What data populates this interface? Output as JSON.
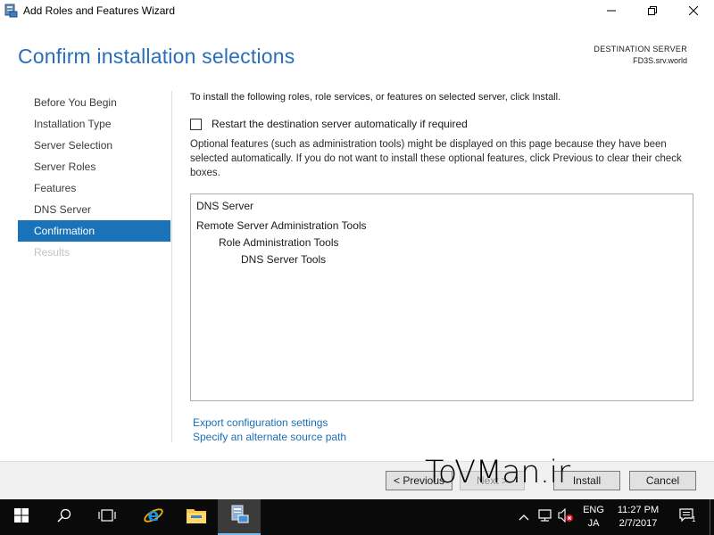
{
  "window": {
    "title": "Add Roles and Features Wizard"
  },
  "header": {
    "page_title": "Confirm installation selections",
    "destination_label": "DESTINATION SERVER",
    "destination_value": "FD3S.srv.world"
  },
  "nav": {
    "items": [
      {
        "label": "Before You Begin",
        "state": "normal"
      },
      {
        "label": "Installation Type",
        "state": "normal"
      },
      {
        "label": "Server Selection",
        "state": "normal"
      },
      {
        "label": "Server Roles",
        "state": "normal"
      },
      {
        "label": "Features",
        "state": "normal"
      },
      {
        "label": "DNS Server",
        "state": "normal"
      },
      {
        "label": "Confirmation",
        "state": "active"
      },
      {
        "label": "Results",
        "state": "disabled"
      }
    ]
  },
  "main": {
    "intro": "To install the following roles, role services, or features on selected server, click Install.",
    "restart_checkbox_label": "Restart the destination server automatically if required",
    "restart_checked": false,
    "optional_text": "Optional features (such as administration tools) might be displayed on this page because they have been selected automatically. If you do not want to install these optional features, click Previous to clear their check boxes.",
    "selections": [
      {
        "label": "DNS Server",
        "level": 0
      },
      {
        "label": "Remote Server Administration Tools",
        "level": 0
      },
      {
        "label": "Role Administration Tools",
        "level": 1
      },
      {
        "label": "DNS Server Tools",
        "level": 2
      }
    ],
    "export_link": "Export configuration settings",
    "alt_source_link": "Specify an alternate source path"
  },
  "footer": {
    "previous_label": "< Previous",
    "next_label": "Next >",
    "install_label": "Install",
    "cancel_label": "Cancel"
  },
  "watermark": "ToVMan.ir",
  "taskbar": {
    "lang_line1": "ENG",
    "lang_line2": "JA",
    "time": "11:27 PM",
    "date": "2/7/2017",
    "notification_count": "1"
  },
  "colors": {
    "accent": "#1a73b9",
    "title_blue": "#2a6ebb",
    "link": "#1a6fb4"
  }
}
